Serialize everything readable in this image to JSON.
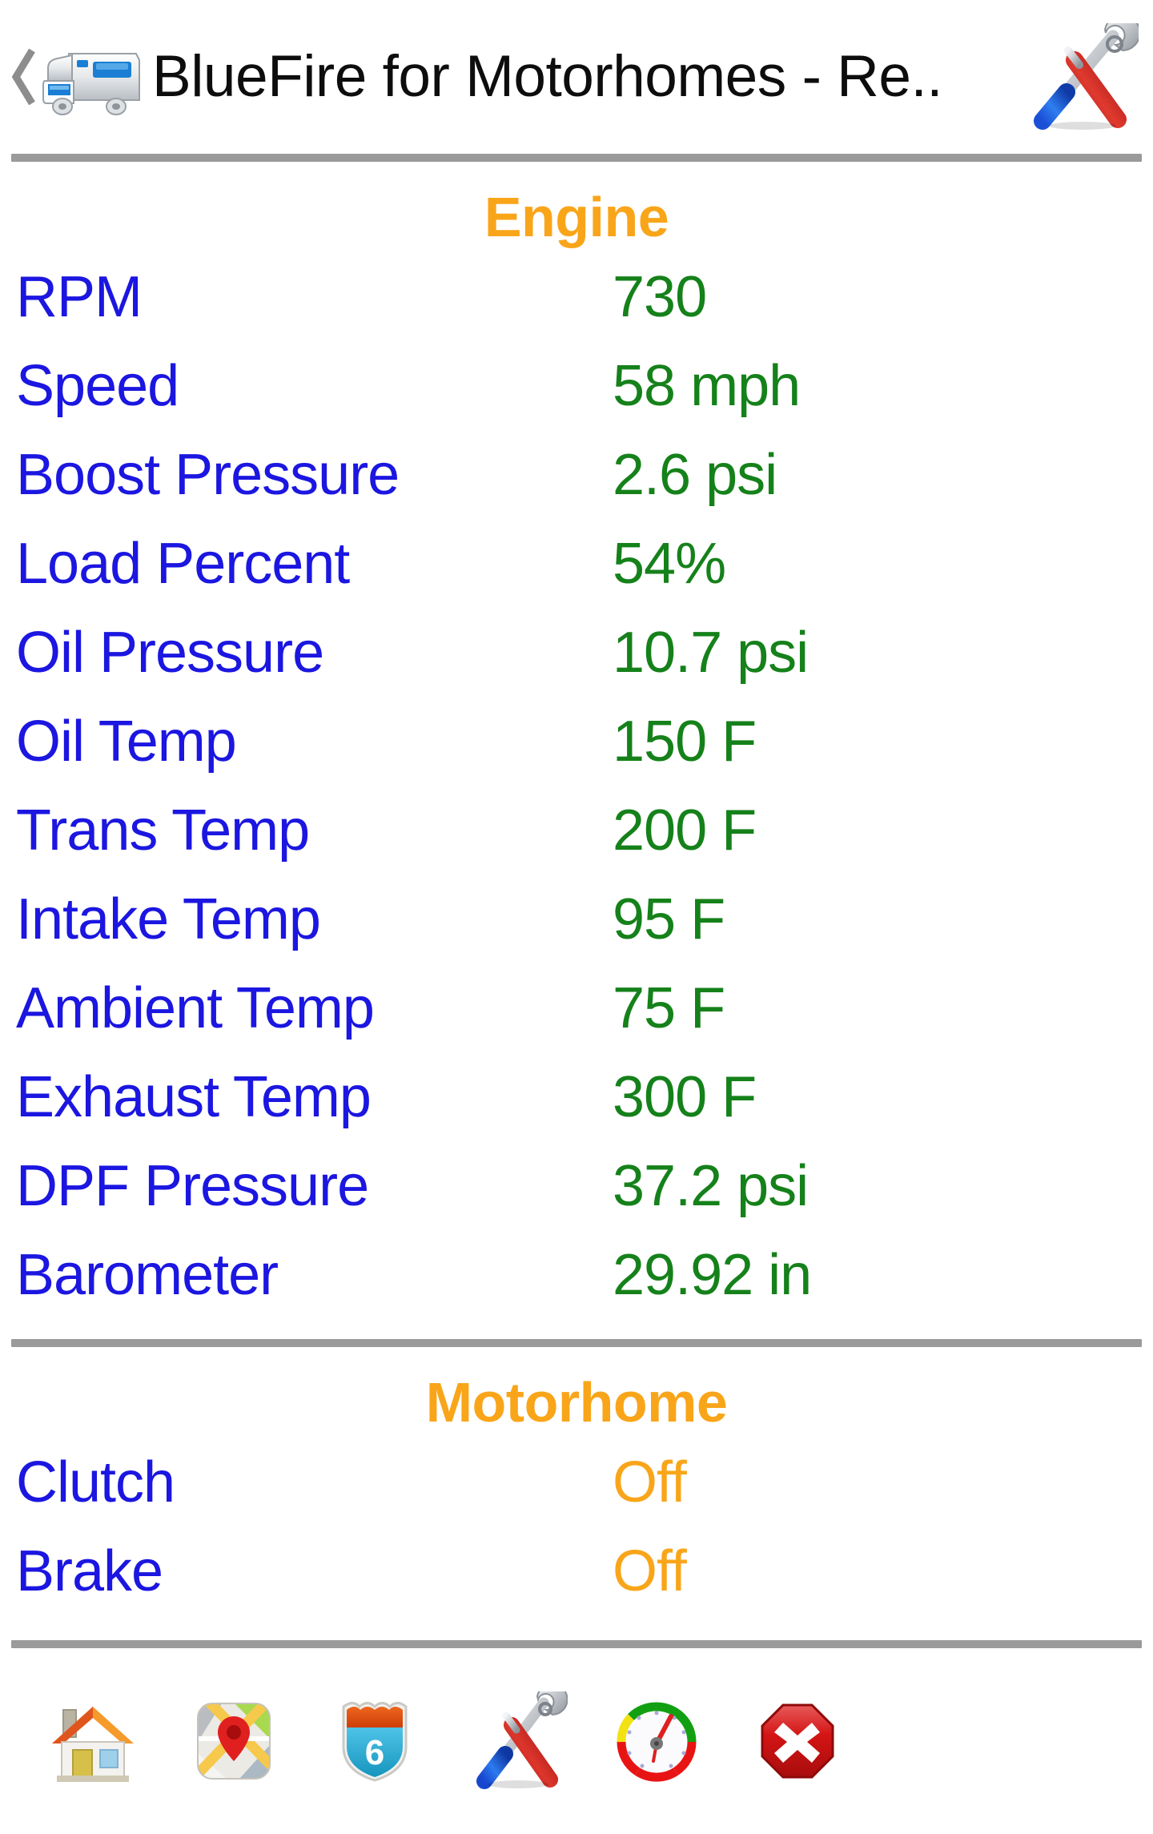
{
  "header": {
    "back_icon": "back-chevron-icon",
    "app_icon": "motorhome-rv-icon",
    "title": "BlueFire for Motorhomes - Re..",
    "action_icon": "tools-icon"
  },
  "colors": {
    "label_blue": "#1b16e0",
    "value_green": "#15811a",
    "accent_orange": "#f9a51a",
    "divider_gray": "#9a9a9a",
    "title_black": "#0d0d0d",
    "background": "#ffffff"
  },
  "sections": [
    {
      "title": "Engine",
      "rows": [
        {
          "label": "RPM",
          "value": "730",
          "state": "ok"
        },
        {
          "label": "Speed",
          "value": "58 mph",
          "state": "ok"
        },
        {
          "label": "Boost Pressure",
          "value": "2.6 psi",
          "state": "ok"
        },
        {
          "label": "Load Percent",
          "value": "54%",
          "state": "ok"
        },
        {
          "label": "Oil Pressure",
          "value": "10.7 psi",
          "state": "ok"
        },
        {
          "label": "Oil Temp",
          "value": "150 F",
          "state": "ok"
        },
        {
          "label": "Trans Temp",
          "value": "200 F",
          "state": "ok"
        },
        {
          "label": "Intake Temp",
          "value": "95 F",
          "state": "ok"
        },
        {
          "label": "Ambient Temp",
          "value": "75 F",
          "state": "ok"
        },
        {
          "label": "Exhaust Temp",
          "value": "300 F",
          "state": "ok"
        },
        {
          "label": "DPF Pressure",
          "value": "37.2 psi",
          "state": "ok"
        },
        {
          "label": "Barometer",
          "value": "29.92 in",
          "state": "ok"
        }
      ]
    },
    {
      "title": "Motorhome",
      "rows": [
        {
          "label": "Clutch",
          "value": "Off",
          "state": "warn"
        },
        {
          "label": "Brake",
          "value": "Off",
          "state": "warn"
        }
      ]
    }
  ],
  "navbar": {
    "items": [
      {
        "name": "home-icon",
        "label": "Home"
      },
      {
        "name": "map-icon",
        "label": "Map"
      },
      {
        "name": "highway-shield-icon",
        "label": "6"
      },
      {
        "name": "tools-icon",
        "label": "Tools"
      },
      {
        "name": "gauge-icon",
        "label": "Gauges"
      },
      {
        "name": "stop-icon",
        "label": "Exit"
      }
    ]
  }
}
